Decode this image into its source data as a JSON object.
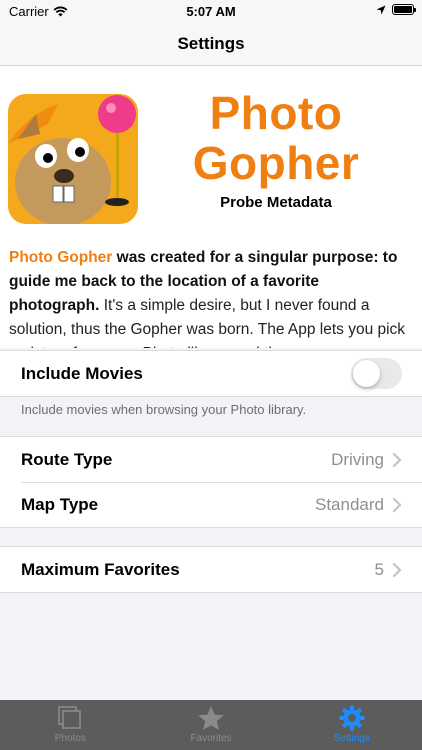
{
  "status_bar": {
    "carrier": "Carrier",
    "time": "5:07 AM"
  },
  "nav": {
    "title": "Settings"
  },
  "header": {
    "brand_line1": "Photo",
    "brand_line2": "Gopher",
    "subtitle": "Probe Metadata",
    "desc_accent": "Photo Gopher",
    "desc_bold": " was created for a singular purpose: to guide me back to the location of a favorite photograph.",
    "desc_rest": " It's a simple desire, but I never found a solution, thus the Gopher was born. The App lets you pick a picture from your Photo library and then"
  },
  "settings": {
    "include_movies": {
      "label": "Include Movies",
      "enabled": false,
      "footer": "Include movies when browsing your Photo library."
    },
    "route_type": {
      "label": "Route Type",
      "value": "Driving"
    },
    "map_type": {
      "label": "Map Type",
      "value": "Standard"
    },
    "max_favorites": {
      "label": "Maximum Favorites",
      "value": "5"
    }
  },
  "tabs": [
    {
      "label": "Photos",
      "icon": "photos-icon",
      "active": false
    },
    {
      "label": "Favorites",
      "icon": "star-icon",
      "active": false
    },
    {
      "label": "Settings",
      "icon": "gear-icon",
      "active": true
    }
  ],
  "colors": {
    "accent": "#f07f11",
    "tab_active": "#1e8cff",
    "tab_bar": "#5c5c5c"
  }
}
